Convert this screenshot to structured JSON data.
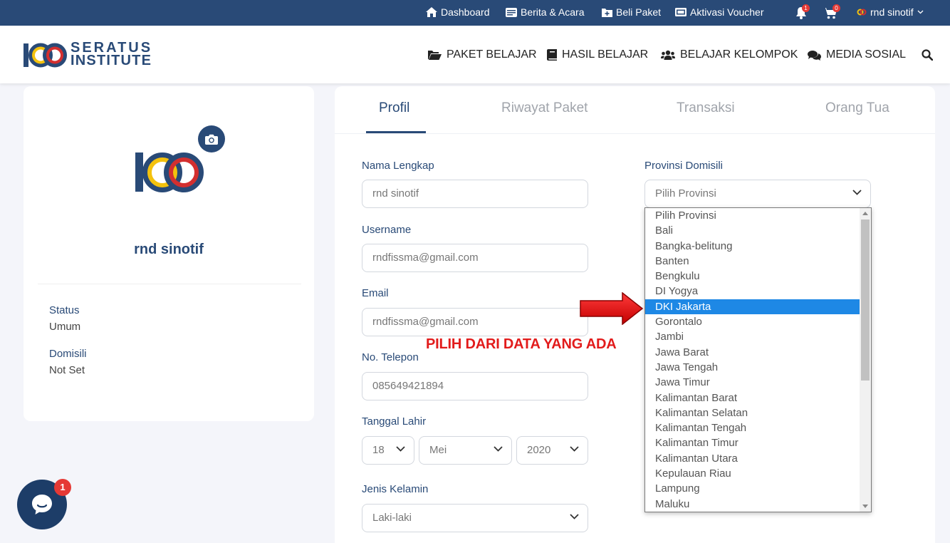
{
  "topbar": {
    "dashboard": "Dashboard",
    "berita": "Berita & Acara",
    "beli_paket": "Beli Paket",
    "aktivasi": "Aktivasi Voucher",
    "notif_count": "1",
    "cart_count": "0",
    "user": "rnd sinotif"
  },
  "brand": {
    "line1": "SERATUS",
    "line2": "INSTITUTE"
  },
  "nav": {
    "paket": "PAKET BELAJAR",
    "hasil": "HASIL BELAJAR",
    "kelompok": "BELAJAR KELOMPOK",
    "media": "MEDIA SOSIAL"
  },
  "profile_card": {
    "name": "rnd sinotif",
    "status_label": "Status",
    "status_value": "Umum",
    "domisili_label": "Domisili",
    "domisili_value": "Not Set"
  },
  "tabs": [
    "Profil",
    "Riwayat Paket",
    "Transaksi",
    "Orang Tua"
  ],
  "form": {
    "nama_label": "Nama Lengkap",
    "nama_value": "rnd sinotif",
    "username_label": "Username",
    "username_value": "rndfissma@gmail.com",
    "email_label": "Email",
    "email_value": "rndfissma@gmail.com",
    "telepon_label": "No. Telepon",
    "telepon_value": "085649421894",
    "lahir_label": "Tanggal Lahir",
    "lahir_day": "18",
    "lahir_month": "Mei",
    "lahir_year": "2020",
    "kelamin_label": "Jenis Kelamin",
    "kelamin_value": "Laki-laki",
    "provinsi_label": "Provinsi Domisili",
    "provinsi_value": "Pilih Provinsi"
  },
  "provinsi_options": [
    "Pilih Provinsi",
    "Bali",
    "Bangka-belitung",
    "Banten",
    "Bengkulu",
    "DI Yogya",
    "DKI Jakarta",
    "Gorontalo",
    "Jambi",
    "Jawa Barat",
    "Jawa Tengah",
    "Jawa Timur",
    "Kalimantan Barat",
    "Kalimantan Selatan",
    "Kalimantan Tengah",
    "Kalimantan Timur",
    "Kalimantan Utara",
    "Kepulauan Riau",
    "Lampung",
    "Maluku"
  ],
  "provinsi_highlighted": "DKI Jakarta",
  "annotation": "PILIH DARI DATA YANG ADA",
  "chat_badge": "1",
  "colors": {
    "primary": "#294a77",
    "highlight": "#1e88e5",
    "annotation": "#e21b1b"
  }
}
